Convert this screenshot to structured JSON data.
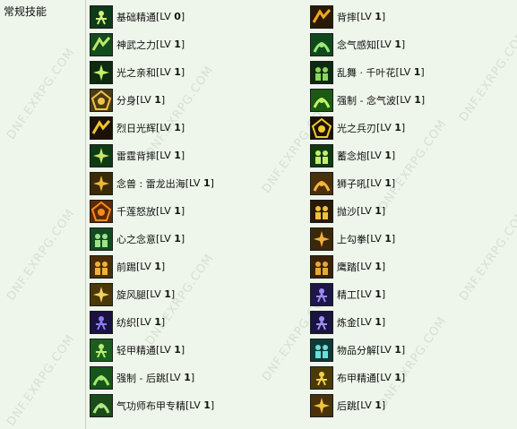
{
  "section_label": "常规技能",
  "watermark_text": "DNF.EXRPG.COM",
  "level_prefix": "[LV ",
  "level_suffix": "]",
  "left_skills": [
    {
      "name": "基础精通",
      "level": "0",
      "icon": "basic-mastery-icon",
      "bg": "#0d3a18",
      "fg": "#d8f07a"
    },
    {
      "name": "神武之力",
      "level": "1",
      "icon": "divine-force-icon",
      "bg": "#114b1e",
      "fg": "#bfe86a"
    },
    {
      "name": "光之亲和",
      "level": "1",
      "icon": "light-affinity-icon",
      "bg": "#0e2a10",
      "fg": "#c6f26a"
    },
    {
      "name": "分身",
      "level": "1",
      "icon": "clone-icon",
      "bg": "#4a3b10",
      "fg": "#f2c14a"
    },
    {
      "name": "烈日光辉",
      "level": "1",
      "icon": "sun-radiance-icon",
      "bg": "#1b1205",
      "fg": "#f2c52a"
    },
    {
      "name": "雷霆背摔",
      "level": "1",
      "icon": "thunder-suplex-icon",
      "bg": "#0f3b14",
      "fg": "#c8e66a"
    },
    {
      "name": "念兽 : 雷龙出海",
      "level": "1",
      "icon": "thunder-dragon-icon",
      "bg": "#3a2a08",
      "fg": "#f0b733"
    },
    {
      "name": "千莲怒放",
      "level": "1",
      "icon": "lotus-bloom-icon",
      "bg": "#5a2a05",
      "fg": "#ff8a1e"
    },
    {
      "name": "心之念意",
      "level": "1",
      "icon": "heart-will-icon",
      "bg": "#124a22",
      "fg": "#9ee38a"
    },
    {
      "name": "前踢",
      "level": "1",
      "icon": "front-kick-icon",
      "bg": "#4a2e08",
      "fg": "#f5b03a"
    },
    {
      "name": "旋风腿",
      "level": "1",
      "icon": "whirlwind-kick-icon",
      "bg": "#4a3808",
      "fg": "#f0d060"
    },
    {
      "name": "纺织",
      "level": "1",
      "icon": "weaving-icon",
      "bg": "#1a1240",
      "fg": "#8a7cf0"
    },
    {
      "name": "轻甲精通",
      "level": "1",
      "icon": "light-armor-mastery-icon",
      "bg": "#1c5e1f",
      "fg": "#b8ee6a"
    },
    {
      "name": "强制 - 后跳",
      "level": "1",
      "icon": "forced-backstep-icon",
      "bg": "#15551c",
      "fg": "#a8e870"
    },
    {
      "name": "气功师布甲专精",
      "level": "1",
      "icon": "cloth-armor-specialty-icon",
      "bg": "#1b4a1b",
      "fg": "#b0e880"
    }
  ],
  "right_skills": [
    {
      "name": "背摔",
      "level": "1",
      "icon": "suplex-icon",
      "bg": "#2a1a05",
      "fg": "#f2a81e"
    },
    {
      "name": "念气感知",
      "level": "1",
      "icon": "nen-sense-icon",
      "bg": "#0f4a1c",
      "fg": "#9de87a"
    },
    {
      "name": "乱舞 · 千叶花",
      "level": "1",
      "icon": "leaf-dance-icon",
      "bg": "#0e2a10",
      "fg": "#86d85a"
    },
    {
      "name": "强制 - 念气波",
      "level": "1",
      "icon": "forced-nen-wave-icon",
      "bg": "#1a5a12",
      "fg": "#c2f26a"
    },
    {
      "name": "光之兵刃",
      "level": "1",
      "icon": "light-blade-icon",
      "bg": "#1a1205",
      "fg": "#f2c830"
    },
    {
      "name": "蓄念炮",
      "level": "1",
      "icon": "nen-cannon-icon",
      "bg": "#0f3a10",
      "fg": "#c6f06a"
    },
    {
      "name": "狮子吼",
      "level": "1",
      "icon": "lion-roar-icon",
      "bg": "#4a3008",
      "fg": "#f2b640"
    },
    {
      "name": "抛沙",
      "level": "1",
      "icon": "throw-sand-icon",
      "bg": "#2a1a05",
      "fg": "#f0c040"
    },
    {
      "name": "上勾拳",
      "level": "1",
      "icon": "uppercut-icon",
      "bg": "#3a2808",
      "fg": "#f0b040"
    },
    {
      "name": "鹰踏",
      "level": "1",
      "icon": "eagle-step-icon",
      "bg": "#3a2208",
      "fg": "#e8a838"
    },
    {
      "name": "精工",
      "level": "1",
      "icon": "craftsmanship-icon",
      "bg": "#1e1648",
      "fg": "#9a8af0"
    },
    {
      "name": "炼金",
      "level": "1",
      "icon": "alchemy-icon",
      "bg": "#1a1440",
      "fg": "#a090f0"
    },
    {
      "name": "物品分解",
      "level": "1",
      "icon": "item-disassemble-icon",
      "bg": "#0e3a3a",
      "fg": "#6ae0d8"
    },
    {
      "name": "布甲精通",
      "level": "1",
      "icon": "cloth-armor-mastery-icon",
      "bg": "#4a3a08",
      "fg": "#f0d050"
    },
    {
      "name": "后跳",
      "level": "1",
      "icon": "backstep-icon",
      "bg": "#4a3208",
      "fg": "#f0c040"
    }
  ]
}
